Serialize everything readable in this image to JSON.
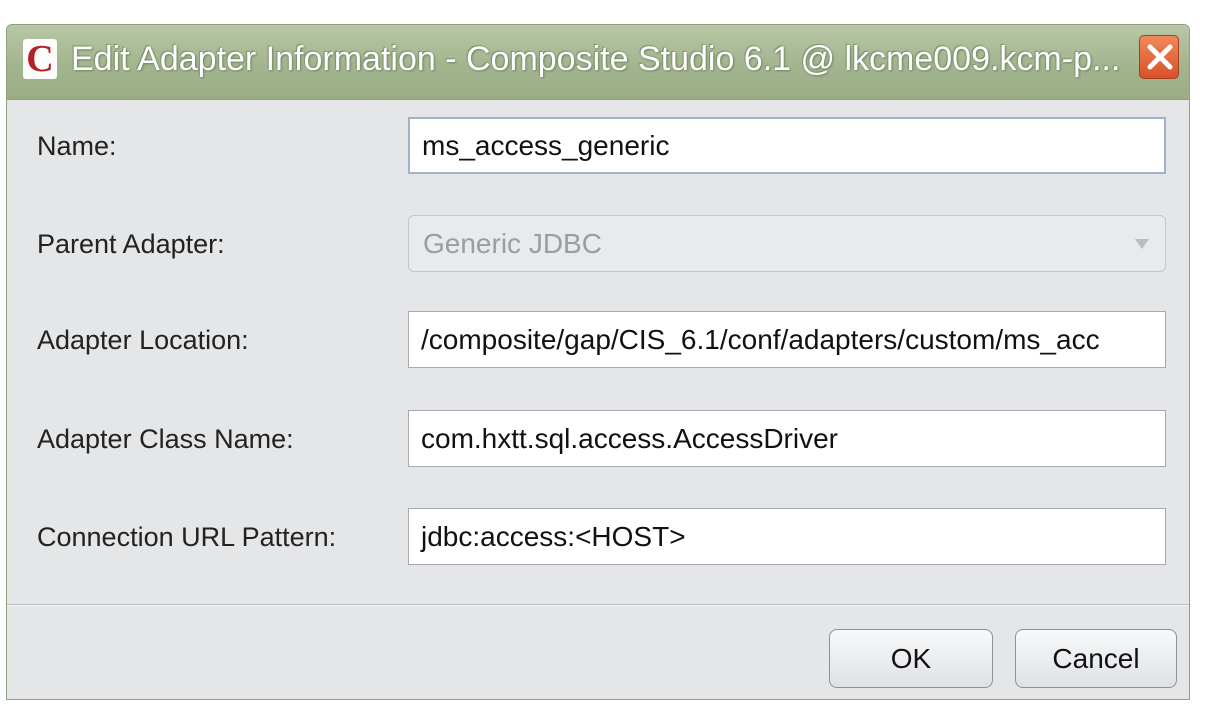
{
  "window": {
    "title": "Edit Adapter Information - Composite Studio 6.1 @ lkcme009.kcm-p...",
    "app_icon_letter": "C",
    "close_icon": "close-x-icon"
  },
  "form": {
    "name_label": "Name:",
    "name_value": "ms_access_generic",
    "parent_label": "Parent Adapter:",
    "parent_value": "Generic JDBC",
    "location_label": "Adapter Location:",
    "location_value": "/composite/gap/CIS_6.1/conf/adapters/custom/ms_acc",
    "class_label": "Adapter Class Name:",
    "class_value": "com.hxtt.sql.access.AccessDriver",
    "url_label": "Connection URL Pattern:",
    "url_value": "jdbc:access:<HOST>"
  },
  "buttons": {
    "ok_label": "OK",
    "cancel_label": "Cancel"
  },
  "colors": {
    "titlebar": "#a3b58f",
    "close_button": "#d9502a",
    "app_icon_letter": "#b41f28"
  }
}
